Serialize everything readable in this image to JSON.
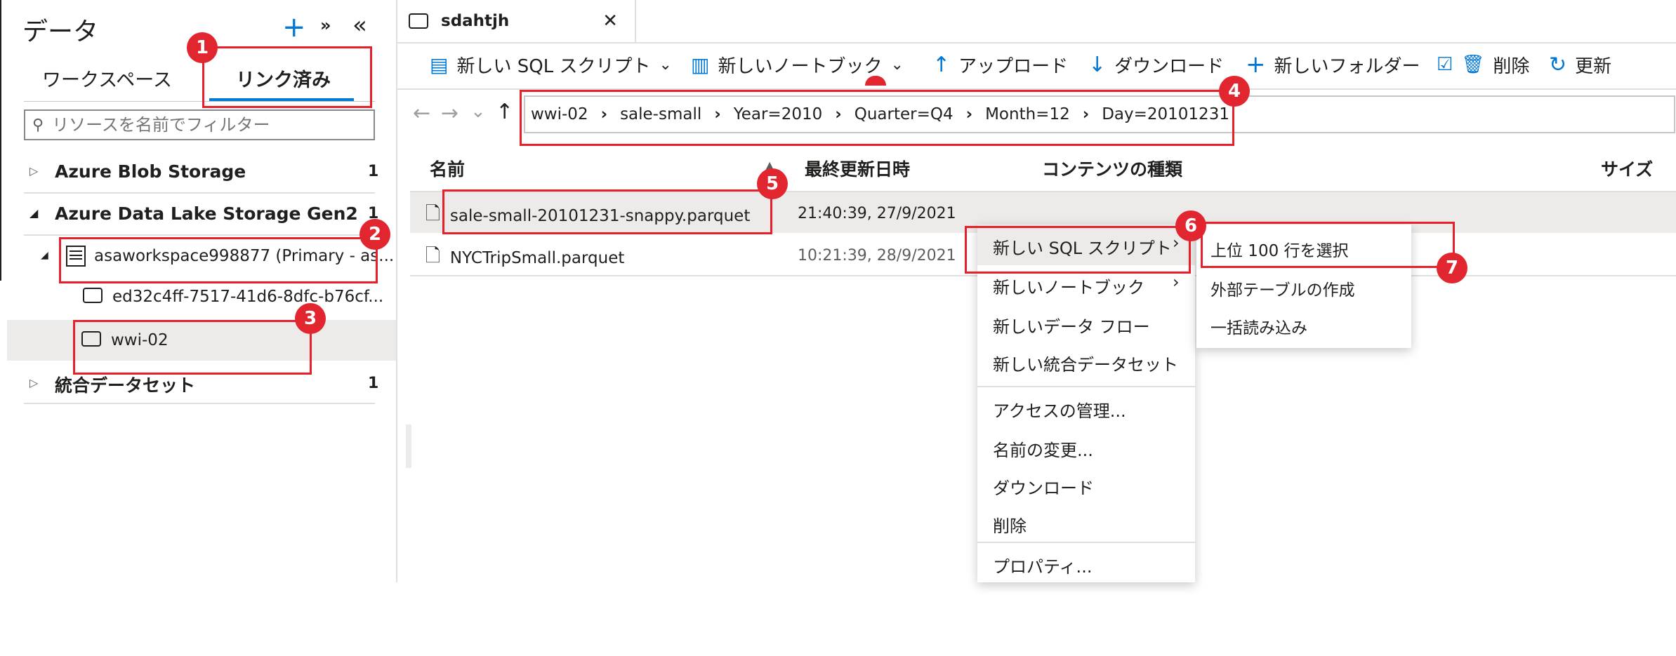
{
  "left": {
    "title": "データ",
    "tabs": [
      "ワークスペース",
      "リンク済み"
    ],
    "filter_placeholder": "リソースを名前でフィルター",
    "tree": {
      "blob": {
        "label": "Azure Blob Storage",
        "count": "1"
      },
      "adls": {
        "label": "Azure Data Lake Storage Gen2",
        "count": "1"
      },
      "workspace": "asaworkspace998877 (Primary - as...",
      "container1": "ed32c4ff-7517-41d6-8dfc-b76cf...",
      "container2": "wwi-02",
      "integrated": {
        "label": "統合データセット",
        "count": "1"
      }
    }
  },
  "doc_tab": {
    "title": "sdahtjh"
  },
  "toolbar": {
    "new_sql": "新しい SQL スクリプト",
    "new_notebook": "新しいノートブック",
    "upload": "アップロード",
    "download": "ダウンロード",
    "new_folder": "新しいフォルダー",
    "delete": "削除",
    "refresh": "更新"
  },
  "breadcrumb": [
    "wwi-02",
    "sale-small",
    "Year=2010",
    "Quarter=Q4",
    "Month=12",
    "Day=20101231"
  ],
  "columns": {
    "name": "名前",
    "modified": "最終更新日時",
    "content_type": "コンテンツの種類",
    "size": "サイズ"
  },
  "files": [
    {
      "name": "sale-small-20101231-snappy.parquet",
      "modified": "21:40:39, 27/9/2021"
    },
    {
      "name": "NYCTripSmall.parquet",
      "modified": "10:21:39, 28/9/2021"
    }
  ],
  "context_menu": {
    "items": [
      "新しい SQL スクリプト",
      "新しいノートブック",
      "新しいデータ フロー",
      "新しい統合データセット",
      "アクセスの管理...",
      "名前の変更...",
      "ダウンロード",
      "削除",
      "プロパティ..."
    ]
  },
  "submenu": {
    "items": [
      "上位 100 行を選択",
      "外部テーブルの作成",
      "一括読み込み"
    ]
  },
  "badges": [
    "1",
    "2",
    "3",
    "4",
    "5",
    "6",
    "7"
  ],
  "colors": {
    "accent": "#0078d4",
    "annotation": "#e8202c",
    "selected_row": "#edebe9"
  }
}
